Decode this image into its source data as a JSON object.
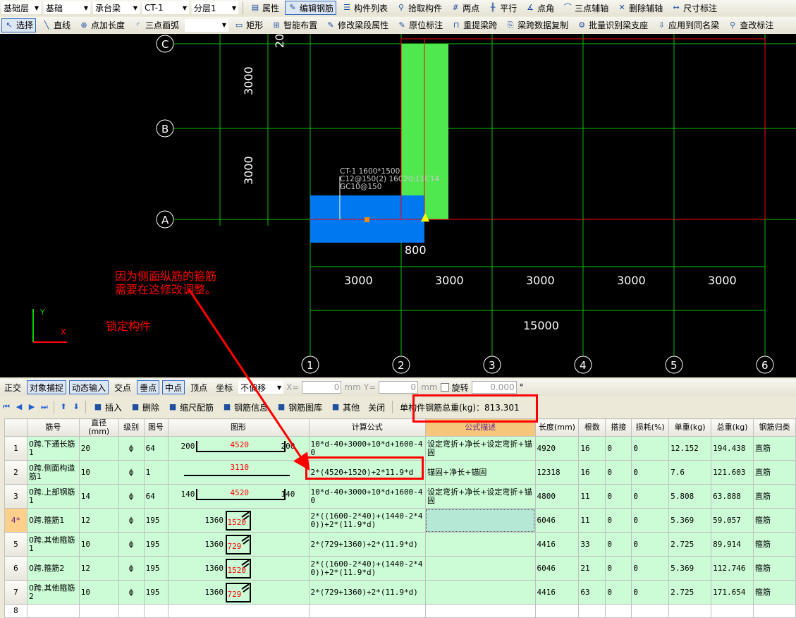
{
  "toolbar1": {
    "selects": [
      "基础层",
      "基础",
      "承台梁",
      "CT-1",
      "分层1"
    ],
    "buttons": [
      {
        "label": "属性",
        "icon": "properties-icon"
      },
      {
        "label": "编辑钢筋",
        "icon": "edit-rebar-icon",
        "active": true
      },
      {
        "label": "构件列表",
        "icon": "component-list-icon"
      },
      {
        "label": "拾取构件",
        "icon": "pick-icon"
      },
      {
        "label": "两点",
        "icon": "two-point-axis-icon"
      },
      {
        "label": "平行",
        "icon": "parallel-axis-icon"
      },
      {
        "label": "点角",
        "icon": "point-angle-icon"
      },
      {
        "label": "三点辅轴",
        "icon": "three-point-axis-icon"
      },
      {
        "label": "删除辅轴",
        "icon": "delete-axis-icon"
      },
      {
        "label": "尺寸标注",
        "icon": "dimension-icon"
      }
    ]
  },
  "toolbar2": {
    "buttons": [
      {
        "label": "选择",
        "icon": "cursor-icon",
        "active": true
      },
      {
        "label": "直线",
        "icon": "line-icon"
      },
      {
        "label": "点加长度",
        "icon": "point-length-icon"
      },
      {
        "label": "三点画弧",
        "icon": "arc-icon"
      },
      {
        "label": "矩形",
        "icon": "rectangle-icon"
      },
      {
        "label": "智能布置",
        "icon": "smart-layout-icon"
      },
      {
        "label": "修改梁段属性",
        "icon": "modify-beam-icon"
      },
      {
        "label": "原位标注",
        "icon": "in-place-label-icon"
      },
      {
        "label": "重提梁跨",
        "icon": "re-extract-span-icon"
      },
      {
        "label": "梁跨数据复制",
        "icon": "copy-span-icon"
      },
      {
        "label": "批量识别梁支座",
        "icon": "identify-support-icon"
      },
      {
        "label": "应用到同名梁",
        "icon": "apply-same-icon"
      },
      {
        "label": "查改标注",
        "icon": "check-label-icon"
      }
    ]
  },
  "canvas": {
    "axes_rows": [
      "A",
      "B",
      "C"
    ],
    "axes_cols": [
      "1",
      "2",
      "3",
      "4",
      "5",
      "6"
    ],
    "dim_vertical": [
      "3000",
      "3000",
      "20"
    ],
    "dim_spans": [
      "3000",
      "3000",
      "3000",
      "3000",
      "3000"
    ],
    "dim_total": "15000",
    "dim_800": "800",
    "label_lines": [
      "CT-1 1600*1500",
      "C12@150(2) 16C20;11C14",
      "GC10@150"
    ],
    "annotation": [
      "因为侧面纵筋的箍筋",
      "需要在这修改调整。"
    ],
    "lock_text": "锁定构件",
    "axis_x": "X",
    "axis_y": "Y",
    "colors": {
      "grid": "#00c000",
      "beam": "#ff0000",
      "column": "#4fe84f",
      "cap": "#0078f0",
      "annotation": "#ff0000"
    }
  },
  "snapbar": {
    "items": [
      {
        "label": "正交"
      },
      {
        "label": "对象捕捉",
        "active": true
      },
      {
        "label": "动态输入",
        "active": true
      },
      {
        "label": "交点"
      },
      {
        "label": "垂点",
        "active": true
      },
      {
        "label": "中点",
        "active": true
      },
      {
        "label": "顶点"
      },
      {
        "label": "坐标"
      }
    ],
    "offset": "不偏移",
    "x_label": "X=",
    "x_value": "0",
    "y_label": "Y=",
    "y_value": "0",
    "unit": "mm",
    "rotate_label": "旋转",
    "rotate_value": "0.000",
    "degree": "°"
  },
  "navbar": {
    "buttons": [
      "插入",
      "删除",
      "缩尺配筋",
      "钢筋信息",
      "钢筋图库",
      "其他",
      "关闭"
    ],
    "total_weight": "单构件钢筋总重(kg)：813.301"
  },
  "table": {
    "headers": [
      "筋号",
      "直径(mm)",
      "级别",
      "图号",
      "图形",
      "计算公式",
      "公式描述",
      "长度(mm)",
      "根数",
      "搭接",
      "损耗(%)",
      "单重(kg)",
      "总重(kg)",
      "钢筋归类"
    ],
    "rows": [
      {
        "no": "1",
        "name": "0跨.下通长筋1",
        "dia": "20",
        "grade": "ф",
        "fig": "64",
        "shape": {
          "type": "U",
          "left": "200",
          "mid": "4520",
          "right": "200"
        },
        "formula": "10*d-40+3000+10*d+1600-40",
        "desc": "设定弯折+净长+设定弯折+锚固",
        "len": "4920",
        "count": "16",
        "lap": "0",
        "loss": "0",
        "unit_w": "12.152",
        "total_w": "194.438",
        "cat": "直筋"
      },
      {
        "no": "2",
        "name": "0跨.侧面构造筋1",
        "dia": "10",
        "grade": "ф",
        "fig": "1",
        "shape": {
          "type": "line",
          "mid": "3110"
        },
        "formula": "2*(4520+1520)+2*11.9*d",
        "desc": "锚固+净长+锚固",
        "len": "12318",
        "count": "16",
        "lap": "0",
        "loss": "0",
        "unit_w": "7.6",
        "total_w": "121.603",
        "cat": "直筋"
      },
      {
        "no": "3",
        "name": "0跨.上部钢筋1",
        "dia": "14",
        "grade": "ф",
        "fig": "64",
        "shape": {
          "type": "U",
          "left": "140",
          "mid": "4520",
          "right": "140"
        },
        "formula": "10*d-40+3000+10*d+1600-40",
        "desc": "设定弯折+净长+设定弯折+锚固",
        "len": "4800",
        "count": "11",
        "lap": "0",
        "loss": "0",
        "unit_w": "5.808",
        "total_w": "63.888",
        "cat": "直筋"
      },
      {
        "no": "4*",
        "name": "0跨.箍筋1",
        "dia": "12",
        "grade": "ф",
        "fig": "195",
        "shape": {
          "type": "stirrup",
          "left": "1360",
          "mid": "1520"
        },
        "formula": "2*((1600-2*40)+(1440-2*40))+2*(11.9*d)",
        "desc": "",
        "len": "6046",
        "count": "11",
        "lap": "0",
        "loss": "0",
        "unit_w": "5.369",
        "total_w": "59.057",
        "cat": "箍筋",
        "current": true
      },
      {
        "no": "5",
        "name": "0跨.其他箍筋1",
        "dia": "10",
        "grade": "ф",
        "fig": "195",
        "shape": {
          "type": "stirrup",
          "left": "1360",
          "mid": "729"
        },
        "formula": "2*(729+1360)+2*(11.9*d)",
        "desc": "",
        "len": "4416",
        "count": "33",
        "lap": "0",
        "loss": "0",
        "unit_w": "2.725",
        "total_w": "89.914",
        "cat": "箍筋"
      },
      {
        "no": "6",
        "name": "0跨.箍筋2",
        "dia": "12",
        "grade": "ф",
        "fig": "195",
        "shape": {
          "type": "stirrup",
          "left": "1360",
          "mid": "1520"
        },
        "formula": "2*((1600-2*40)+(1440-2*40))+2*(11.9*d)",
        "desc": "",
        "len": "6046",
        "count": "21",
        "lap": "0",
        "loss": "0",
        "unit_w": "5.369",
        "total_w": "112.746",
        "cat": "箍筋"
      },
      {
        "no": "7",
        "name": "0跨.其他箍筋2",
        "dia": "10",
        "grade": "ф",
        "fig": "195",
        "shape": {
          "type": "stirrup",
          "left": "1360",
          "mid": "729"
        },
        "formula": "2*(729+1360)+2*(11.9*d)",
        "desc": "",
        "len": "4416",
        "count": "63",
        "lap": "0",
        "loss": "0",
        "unit_w": "2.725",
        "total_w": "171.654",
        "cat": "箍筋"
      }
    ],
    "empty_row_no": "8"
  }
}
